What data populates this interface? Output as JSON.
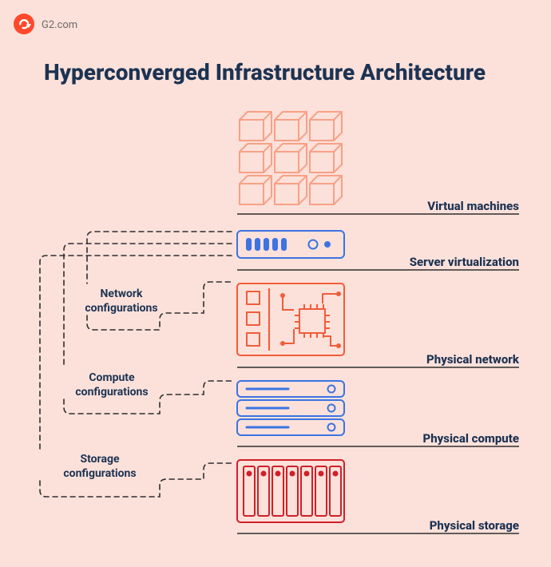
{
  "brand": {
    "name": "G2.com"
  },
  "title": "Hyperconverged Infrastructure Architecture",
  "layers": {
    "vm": {
      "label": "Virtual machines"
    },
    "sv": {
      "label": "Server virtualization"
    },
    "pnet": {
      "label": "Physical network"
    },
    "pcomp": {
      "label": "Physical compute"
    },
    "pstor": {
      "label": "Physical storage"
    }
  },
  "configs": {
    "net": {
      "label1": "Network",
      "label2": "configurations"
    },
    "comp": {
      "label1": "Compute",
      "label2": "configurations"
    },
    "stor": {
      "label1": "Storage",
      "label2": "configurations"
    }
  },
  "colors": {
    "bg": "#FCE1DA",
    "dark": "#1C3353",
    "blue": "#3B74E3",
    "orange": "#F15C3B",
    "red": "#D21F29",
    "salmon": "#F9A086",
    "underline": "#2E2E2E"
  }
}
